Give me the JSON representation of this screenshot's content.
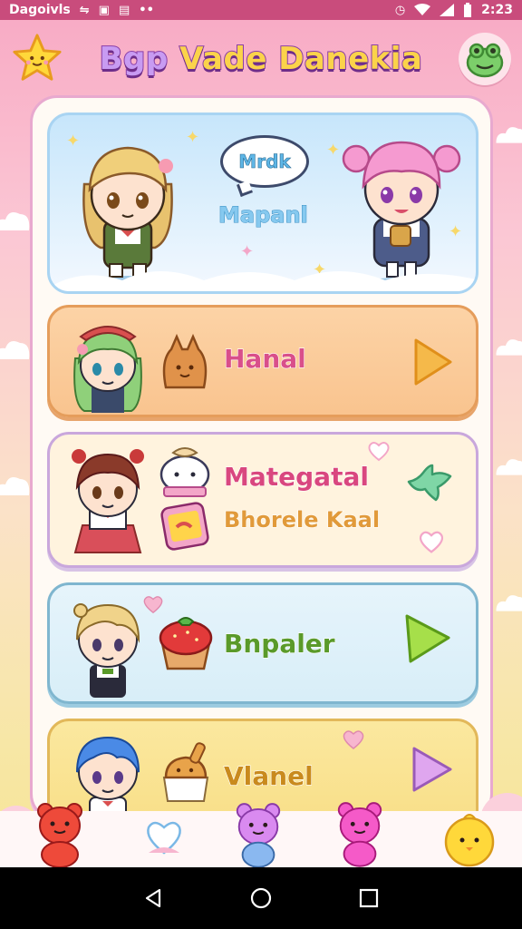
{
  "status_bar": {
    "carrier": "Dagoivls",
    "time": "2:23",
    "icons": [
      "signal-icon",
      "image-icon",
      "notification-icon",
      "more-dots-icon",
      "alarm-icon",
      "wifi-icon",
      "cell-signal-icon",
      "battery-icon"
    ]
  },
  "header": {
    "title_part1": "Bgp",
    "title_part2": "Vade Danekia",
    "left_icon": "star-icon",
    "right_icon": "frog-icon"
  },
  "hero": {
    "bubble_text": "Mrdk",
    "subtitle": "Mapanl"
  },
  "menu": {
    "items": [
      {
        "label": "Hanal",
        "character": "green-hair-girl",
        "icon": "bread-icon",
        "arrow_color": "#f5b94a"
      },
      {
        "label": "Mategatal",
        "sublabel": "Bhorele Kaal",
        "character": "red-hair-girl",
        "icon": "cake-jar-icon",
        "arrow_color": "#6fc99a"
      },
      {
        "label": "Bnpaler",
        "character": "blonde-boy",
        "icon": "strawberry-cake-icon",
        "arrow_color": "#9bd84a"
      },
      {
        "label": "Vlanel",
        "character": "blue-hair-boy",
        "icon": "dessert-icon",
        "arrow_color": "#d99ae8"
      }
    ]
  },
  "bottom_nav": {
    "items": [
      "red-bear-icon",
      "heart-icon",
      "purple-bear-icon",
      "pink-bear-icon",
      "yellow-chick-icon"
    ]
  },
  "colors": {
    "status_bar": "#c94c7c",
    "panel_border": "#e8a9cf",
    "accent": "#fbd34a"
  }
}
